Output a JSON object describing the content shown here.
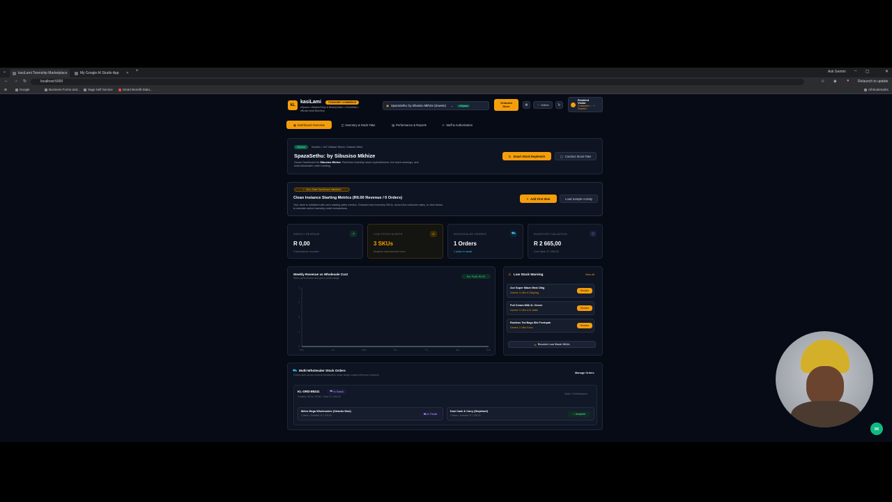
{
  "browser": {
    "tabs": [
      {
        "title": "kasiLami Township Marketplace",
        "active": true
      },
      {
        "title": "My Google AI Studio App",
        "active": false
      }
    ],
    "url": "localhost:5000",
    "ask_gemini": "Ask Gemini",
    "relaunch": "Relaunch to update",
    "bookmarks": [
      "Google",
      "Business Forms and...",
      "Sage Self Service",
      "Smart Benefit Statu..."
    ],
    "all_bookmarks": "All Bookmarks"
  },
  "header": {
    "logo": "kL",
    "brand": "kasiLami",
    "badge": "TOWNSHIP COMMERCE",
    "subtitle_line1": "eSpaza • eBarberShop & BeautySalon • eCarWash •",
    "subtitle_line2": "eBraai-meat Butchery",
    "store_select": "SpazaSethu: by Sibusiso Mkhize (Soweto)",
    "store_tag": "eSpaza",
    "onboard_line1": "Onboard",
    "onboard_line2": "Store",
    "online": "Online",
    "user_name_line1": "Resident",
    "user_name_line2": "Visitor",
    "user_role_line1": "Customer •",
    "user_role_line2": "Soweto"
  },
  "nav": {
    "tabs": [
      "Dashboard Overview",
      "Inventory & Stock-Take",
      "Performance & Reports",
      "Staff & Authorization"
    ]
  },
  "store_card": {
    "tag": "eSpaza",
    "address": "Soweto • 142 Vilakazi Street, Orlando West",
    "title": "SpazaSethu: by Sibusiso Mkhize",
    "desc_line1_pre": "Owner Dashboard for ",
    "desc_name": "Sibusiso Mkhize",
    "desc_line1_post": ". Real-time township stock replenishment, live stock warnings, and",
    "desc_line2": "multi-wholesaler order tracking.",
    "btn_replenish": "Smart Stock Replenish",
    "btn_stocktake": "Conduct Stock-Take"
  },
  "zero_card": {
    "badge": "Zero-State Dashboard Initialized",
    "title": "Clean Instance Starting Metrics (R0.00 Revenue / 0 Orders)",
    "desc_line1": "Your store is initialized with zero starting sales metrics. Onboard new inventory SKUs, record live customer sales, or click below",
    "desc_line2": "to simulate active township order transactions.",
    "btn_add": "Add First Item",
    "btn_sample": "Load Sample Activity"
  },
  "stats": [
    {
      "label": "WEEKLY REVENUE",
      "value": "R 0,00",
      "sub": "0 transactions recorded",
      "icon": "trend-up-icon"
    },
    {
      "label": "LOW STOCK ALERTS",
      "value": "3 SKUs",
      "sub": "Requires replenishment soon",
      "icon": "warning-icon"
    },
    {
      "label": "WHOLESALER ORDERS",
      "value": "1 Orders",
      "sub": "1 active in transit",
      "icon": "truck-icon"
    },
    {
      "label": "INVENTORY VALUATION",
      "value": "R 2 665,00",
      "sub": "Cost Value: R 1 890,00",
      "icon": "box-icon"
    }
  ],
  "chart_data": {
    "type": "area",
    "title": "Weekly Revenue vs Wholesale Cost",
    "subtitle": "Sales performance and gross profit margin",
    "badge": "Est. Profit: R0.00",
    "categories": [
      "Mon",
      "Tue",
      "Wed",
      "Thu",
      "Fri",
      "Sat",
      "Sun"
    ],
    "yticks": [
      "4",
      "3",
      "2",
      "1",
      "0"
    ],
    "series": [
      {
        "values": [
          0,
          0,
          0,
          0,
          0,
          0,
          0
        ]
      },
      {
        "values": [
          0,
          0,
          0,
          0,
          0,
          0,
          0
        ]
      }
    ],
    "ylim": [
      0,
      4
    ]
  },
  "low_stock": {
    "title": "Low Stock Warning",
    "view_all": "View All",
    "items": [
      {
        "name": "Ace Super Maize Meal 10kg",
        "detail": "Current: 4 / Min: 8 10kg bag",
        "action": "Reorder"
      },
      {
        "name": "Full Cream Milk 2L Clover",
        "detail": "Current: 3 / Min: 8 2L bottle",
        "action": "Reorder"
      },
      {
        "name": "Rooibos Tea Bags 80s Freshpak",
        "detail": "Current: 2 / Min: 5 box",
        "action": "Reorder"
      }
    ],
    "reorder_all": "Reorder Low Stock SKUs"
  },
  "orders": {
    "title": "Multi-Wholesaler Stock Orders",
    "subtitle": "Orders split across several wholesalers under single unique reference numbers",
    "manage": "Manage Orders",
    "order": {
      "id": "KL-ORD-89241",
      "status": "In Transit",
      "meta": "Created: 08 Jul, 09:30 • Total: R 1 490,00",
      "splits": "Splits: 2 Wholesalers",
      "parts": [
        {
          "name": "Metro Mega Wholesalers (Orlando East)",
          "detail": "3 Items • Subtotal: R 1 100,00",
          "status": "In Transit"
        },
        {
          "name": "Kasi Cash & Carry (Diepkloof)",
          "detail": "2 Items • Subtotal: R 1 390,00",
          "status": "Accepted"
        }
      ]
    }
  }
}
